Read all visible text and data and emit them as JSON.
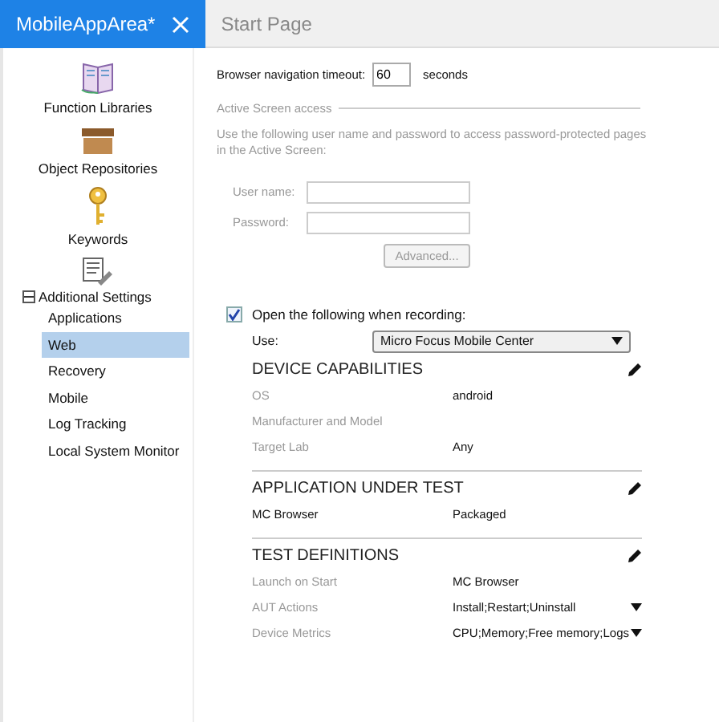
{
  "tabs": [
    {
      "label": "MobileAppArea*",
      "selected": true,
      "closable": true
    },
    {
      "label": "Start Page",
      "selected": false,
      "closable": false
    }
  ],
  "sidebar": {
    "items": [
      {
        "kind": "icon",
        "label": "Function Libraries"
      },
      {
        "kind": "icon",
        "label": "Object Repositories"
      },
      {
        "kind": "icon",
        "label": "Keywords"
      },
      {
        "kind": "tree",
        "label": "Additional Settings",
        "expanded": true,
        "children": [
          {
            "label": "Applications",
            "selected": false
          },
          {
            "label": "Web",
            "selected": true
          },
          {
            "label": "Recovery",
            "selected": false
          },
          {
            "label": "Mobile",
            "selected": false
          },
          {
            "label": "Log Tracking",
            "selected": false
          },
          {
            "label": "Local System Monitor",
            "selected": false
          }
        ]
      }
    ]
  },
  "timeout": {
    "label": "Browser navigation timeout:",
    "value": "60",
    "unit": "seconds"
  },
  "active_screen": {
    "title": "Active Screen access",
    "description": "Use the following user name and password to access password-protected pages in the Active Screen:",
    "disabled": true,
    "fields": [
      {
        "label": "User name:"
      },
      {
        "label": "Password:"
      }
    ],
    "button": "Advanced..."
  },
  "record": {
    "label": "Open the following when recording:",
    "checked": true,
    "use_label": "Use:",
    "use_value": "Micro Focus Mobile Center"
  },
  "sections": [
    {
      "title": "DEVICE CAPABILITIES",
      "rows": [
        {
          "label": "OS",
          "value": "android",
          "muted": true
        },
        {
          "label": "Manufacturer and Model",
          "muted": true
        },
        {
          "label": "Target Lab",
          "value": "Any",
          "muted": true
        }
      ]
    },
    {
      "title": "APPLICATION UNDER TEST",
      "rows": [
        {
          "label": "MC Browser",
          "value": "Packaged",
          "muted": false
        }
      ]
    },
    {
      "title": "TEST DEFINITIONS",
      "rows": [
        {
          "label": "Launch on Start",
          "value": "MC Browser",
          "muted": true
        },
        {
          "label": "AUT Actions",
          "value": "Install;Restart;Uninstall",
          "muted": true,
          "dropdown": true
        },
        {
          "label": "Device Metrics",
          "value": "CPU;Memory;Free memory;Logs",
          "muted": true,
          "dropdown": true
        }
      ]
    }
  ]
}
